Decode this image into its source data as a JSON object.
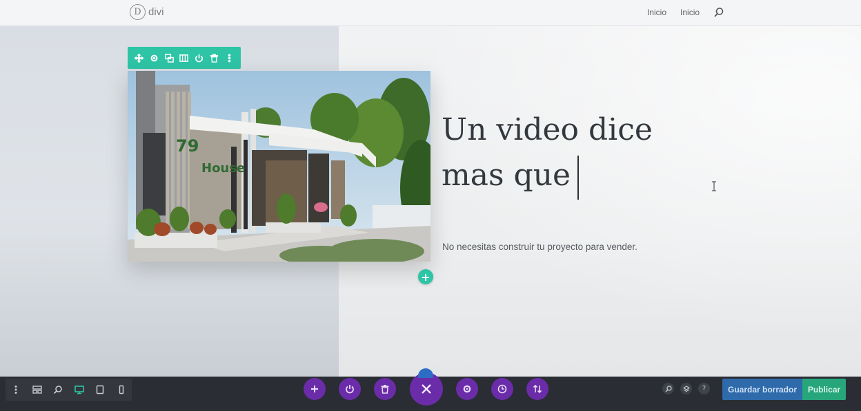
{
  "header": {
    "logo_letter": "D",
    "logo_text": "divi",
    "nav": [
      "Inicio",
      "Inicio"
    ]
  },
  "module_toolbar": {
    "icons": [
      "move-icon",
      "gear-icon",
      "duplicate-icon",
      "columns-icon",
      "power-icon",
      "trash-icon",
      "more-icon"
    ]
  },
  "hero": {
    "image_signage": {
      "number": "79",
      "word": "House"
    },
    "headline_line1": "Un video dice",
    "headline_line2": "mas que",
    "subtext": "No necesitas construir tu proyecto para vender."
  },
  "bottom_bar": {
    "left_icons": [
      "more-icon",
      "layout-icon",
      "zoom-icon",
      "desktop-icon",
      "tablet-icon",
      "phone-icon"
    ],
    "center_icons": [
      "add-icon",
      "power-icon",
      "trash-icon",
      "close-icon",
      "gear-icon",
      "history-icon",
      "sort-icon"
    ],
    "right_icons": [
      "search-icon",
      "layers-icon",
      "help-icon"
    ],
    "help_label": "?",
    "save_draft_label": "Guardar borrador",
    "publish_label": "Publicar"
  },
  "colors": {
    "accent_teal": "#2ec4a6",
    "builder_purple": "#6b2ca9",
    "draft_blue": "#2f6aab",
    "publish_green": "#26a67a"
  }
}
